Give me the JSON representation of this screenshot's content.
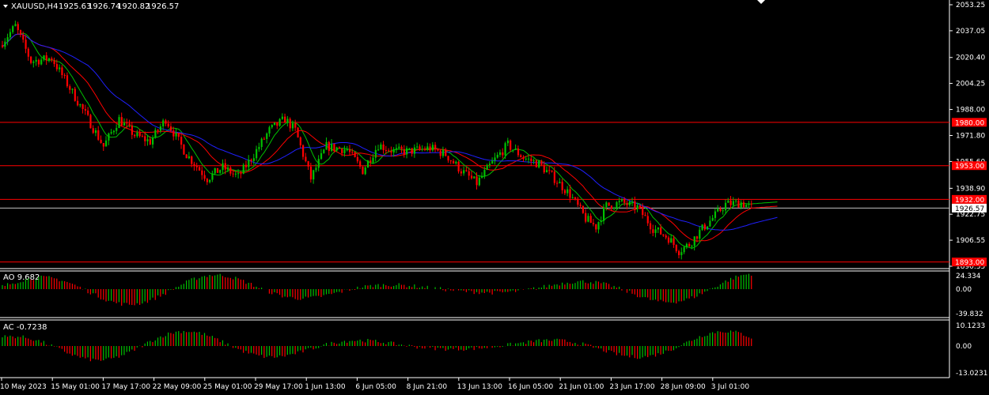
{
  "symbol_header": {
    "symbol": "XAUUSD,H4",
    "open": "1925.63",
    "high": "1926.74",
    "low": "1920.82",
    "close": "1926.57"
  },
  "price_axis": {
    "ticks": [
      "2053.25",
      "2037.05",
      "2020.40",
      "2004.25",
      "1988.00",
      "1971.80",
      "1955.60",
      "1938.90",
      "1922.75",
      "1906.55",
      "1890.35"
    ],
    "current_price": "1926.57"
  },
  "levels": [
    {
      "label": "1980.00",
      "price": 1980.0,
      "color": "#ff0000"
    },
    {
      "label": "1953.00",
      "price": 1953.0,
      "color": "#ff0000"
    },
    {
      "label": "1932.00",
      "price": 1932.0,
      "color": "#ff0000"
    },
    {
      "label": "1893.00",
      "price": 1893.0,
      "color": "#ff0000"
    }
  ],
  "time_axis": [
    "10 May 2023",
    "15 May 01:00",
    "17 May 17:00",
    "22 May 09:00",
    "25 May 01:00",
    "29 May 17:00",
    "1 Jun 13:00",
    "6 Jun 05:00",
    "8 Jun 21:00",
    "13 Jun 13:00",
    "16 Jun 05:00",
    "21 Jun 01:00",
    "23 Jun 17:00",
    "28 Jun 09:00",
    "3 Jul 01:00"
  ],
  "ao": {
    "label": "AO 9.682",
    "ticks": [
      "24.334",
      "0.00",
      "-39.832"
    ]
  },
  "ac": {
    "label": "AC -0.7238",
    "ticks": [
      "10.1233",
      "0.00",
      "-13.0231"
    ]
  },
  "colors": {
    "background": "#000000",
    "bull": "#00c000",
    "bear": "#ff0000",
    "ma_fast": "#00c000",
    "ma_mid": "#ff0000",
    "ma_slow": "#2020ff",
    "axis": "#ffffff",
    "level": "#ff0000",
    "price_line": "#c0c0c0"
  },
  "chart_data": {
    "type": "candlestick",
    "anchors": [
      [
        0,
        2028
      ],
      [
        6,
        2040
      ],
      [
        12,
        2018
      ],
      [
        20,
        2020
      ],
      [
        26,
        2004
      ],
      [
        33,
        1985
      ],
      [
        40,
        1965
      ],
      [
        46,
        1982
      ],
      [
        52,
        1972
      ],
      [
        58,
        1968
      ],
      [
        64,
        1982
      ],
      [
        72,
        1960
      ],
      [
        80,
        1945
      ],
      [
        86,
        1952
      ],
      [
        92,
        1946
      ],
      [
        98,
        1960
      ],
      [
        104,
        1975
      ],
      [
        110,
        1982
      ],
      [
        114,
        1975
      ],
      [
        120,
        1945
      ],
      [
        126,
        1965
      ],
      [
        134,
        1963
      ],
      [
        140,
        1950
      ],
      [
        146,
        1966
      ],
      [
        152,
        1962
      ],
      [
        158,
        1962
      ],
      [
        166,
        1964
      ],
      [
        172,
        1960
      ],
      [
        178,
        1950
      ],
      [
        184,
        1942
      ],
      [
        190,
        1955
      ],
      [
        196,
        1966
      ],
      [
        202,
        1958
      ],
      [
        208,
        1954
      ],
      [
        214,
        1945
      ],
      [
        220,
        1935
      ],
      [
        226,
        1920
      ],
      [
        230,
        1915
      ],
      [
        234,
        1928
      ],
      [
        240,
        1930
      ],
      [
        246,
        1927
      ],
      [
        252,
        1914
      ],
      [
        258,
        1908
      ],
      [
        262,
        1900
      ],
      [
        266,
        1904
      ],
      [
        270,
        1912
      ],
      [
        276,
        1922
      ],
      [
        280,
        1929
      ],
      [
        286,
        1930
      ],
      [
        290,
        1927
      ]
    ],
    "ylim": [
      1890.35,
      2053.25
    ]
  }
}
